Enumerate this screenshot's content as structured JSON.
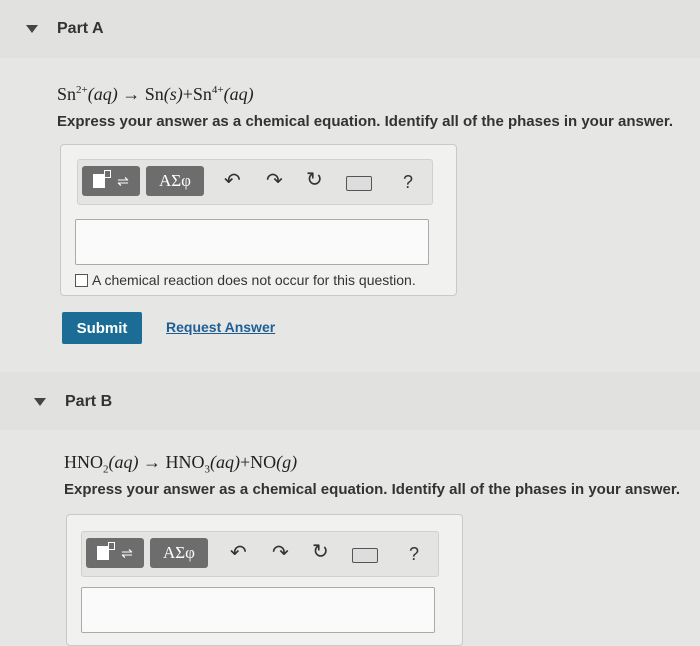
{
  "partA": {
    "title": "Part A",
    "equation": {
      "lhs_species": "Sn",
      "lhs_charge": "2+",
      "lhs_phase": "(aq)",
      "arrow": "→",
      "p1_species": "Sn",
      "p1_phase": "(s)",
      "plus": "+",
      "p2_species": "Sn",
      "p2_charge": "4+",
      "p2_phase": "(aq)"
    },
    "instruction": "Express your answer as a chemical equation. Identify all of the phases in your answer.",
    "toolbar": {
      "greek_label": "ΑΣφ",
      "help_label": "?"
    },
    "answer_value": "",
    "no_reaction_label": "A chemical reaction does not occur for this question.",
    "submit_label": "Submit",
    "request_answer_label": "Request Answer"
  },
  "partB": {
    "title": "Part B",
    "equation": {
      "r_species": "HNO",
      "r_sub": "2",
      "r_phase": "(aq)",
      "arrow": "→",
      "p1_species": "HNO",
      "p1_sub": "3",
      "p1_phase": "(aq)",
      "plus": "+",
      "p2_species": "NO",
      "p2_phase": "(g)"
    },
    "instruction": "Express your answer as a chemical equation. Identify all of the phases in your answer.",
    "toolbar": {
      "greek_label": "ΑΣφ",
      "help_label": "?"
    },
    "answer_value": ""
  },
  "icons": {
    "undo": "undo-icon",
    "redo": "redo-icon",
    "reset": "reset-icon",
    "keyboard": "keyboard-icon",
    "help": "help-icon",
    "template": "template-icon"
  }
}
